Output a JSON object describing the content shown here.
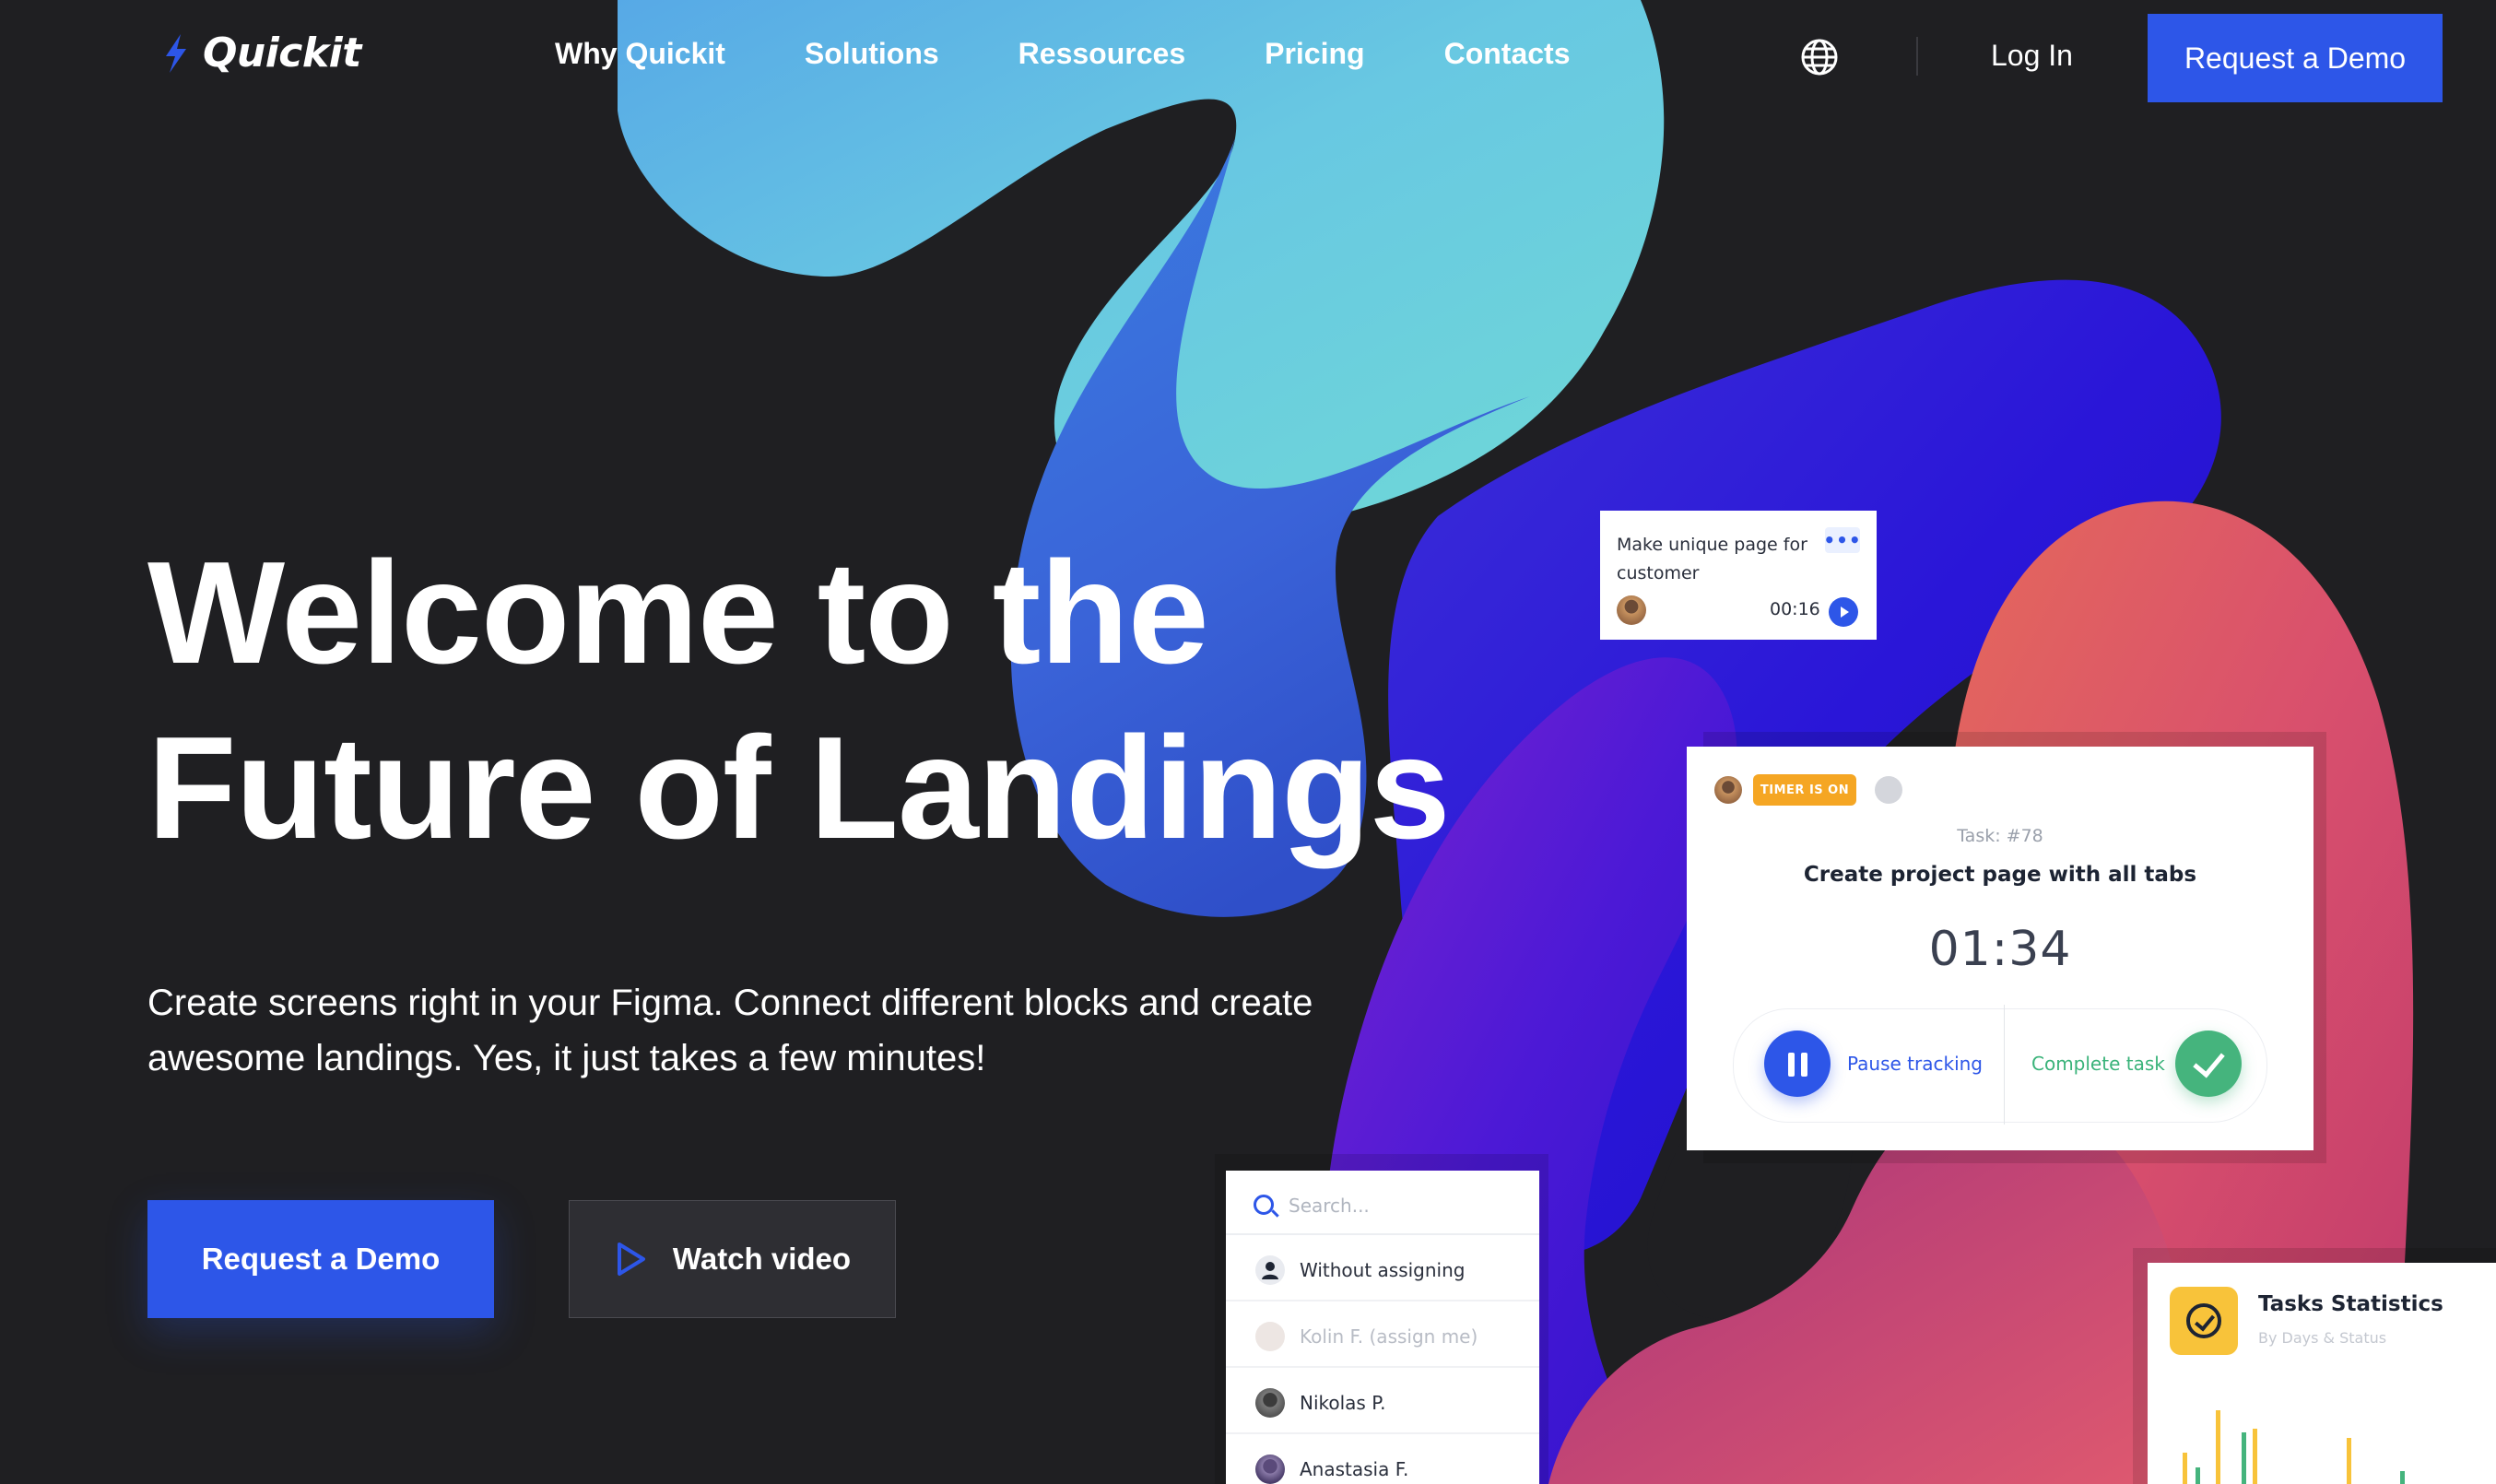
{
  "brand": {
    "name": "Quickit",
    "accent": "#2d56e8"
  },
  "nav": {
    "items": [
      {
        "label": "Why Quickit"
      },
      {
        "label": "Solutions"
      },
      {
        "label": "Ressources"
      },
      {
        "label": "Pricing"
      },
      {
        "label": "Contacts"
      }
    ],
    "login_label": "Log In",
    "cta_label": "Request a Demo",
    "language_icon": "globe-icon"
  },
  "hero": {
    "title_line1": "Welcome to the",
    "title_line2": "Future of Landings",
    "subtitle_line1": "Create screens right in your Figma. Connect different blocks and create",
    "subtitle_line2": "awesome landings. Yes, it just takes a few minutes!",
    "primary_cta": "Request a Demo",
    "secondary_cta": "Watch video"
  },
  "task_card": {
    "title": "Make unique page for customer",
    "menu": "•••",
    "time": "00:16"
  },
  "timer_card": {
    "badge": "TIMER IS ON",
    "task_number": "Task: #78",
    "task_title": "Create project page with all tabs",
    "timer": "01:34",
    "pause_label": "Pause tracking",
    "complete_label": "Complete task",
    "colors": {
      "badge": "#f5a623",
      "complete": "#45b47d"
    }
  },
  "assign_card": {
    "search_placeholder": "Search...",
    "options": [
      {
        "name": "Without assigning"
      },
      {
        "name": "Kolin F.  (assign me)"
      },
      {
        "name": "Nikolas P."
      },
      {
        "name": "Anastasia F."
      }
    ]
  },
  "stats_card": {
    "title": "Tasks Statistics",
    "subtitle": "By Days & Status"
  }
}
